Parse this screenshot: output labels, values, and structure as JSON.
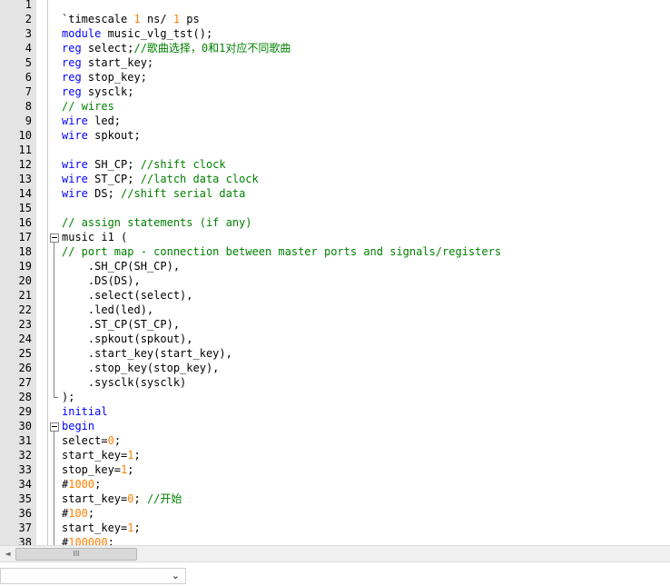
{
  "editor": {
    "lines": [
      {
        "n": "1",
        "tokens": []
      },
      {
        "n": "2",
        "tokens": [
          {
            "t": "`timescale ",
            "c": ""
          },
          {
            "t": "1",
            "c": "num"
          },
          {
            "t": " ns/ ",
            "c": ""
          },
          {
            "t": "1",
            "c": "num"
          },
          {
            "t": " ps",
            "c": ""
          }
        ]
      },
      {
        "n": "3",
        "tokens": [
          {
            "t": "module",
            "c": "kw"
          },
          {
            "t": " music_vlg_tst();",
            "c": ""
          }
        ]
      },
      {
        "n": "4",
        "tokens": [
          {
            "t": "reg",
            "c": "kw"
          },
          {
            "t": " select;",
            "c": ""
          },
          {
            "t": "//歌曲选择，0和1对应不同歌曲",
            "c": "cm"
          }
        ]
      },
      {
        "n": "5",
        "tokens": [
          {
            "t": "reg",
            "c": "kw"
          },
          {
            "t": " start_key;",
            "c": ""
          }
        ]
      },
      {
        "n": "6",
        "tokens": [
          {
            "t": "reg",
            "c": "kw"
          },
          {
            "t": " stop_key;",
            "c": ""
          }
        ]
      },
      {
        "n": "7",
        "tokens": [
          {
            "t": "reg",
            "c": "kw"
          },
          {
            "t": " sysclk;",
            "c": ""
          }
        ]
      },
      {
        "n": "8",
        "tokens": [
          {
            "t": "// wires",
            "c": "cm"
          }
        ]
      },
      {
        "n": "9",
        "tokens": [
          {
            "t": "wire",
            "c": "kw"
          },
          {
            "t": " led;",
            "c": ""
          }
        ]
      },
      {
        "n": "10",
        "tokens": [
          {
            "t": "wire",
            "c": "kw"
          },
          {
            "t": " spkout;",
            "c": ""
          }
        ]
      },
      {
        "n": "11",
        "tokens": []
      },
      {
        "n": "12",
        "tokens": [
          {
            "t": "wire",
            "c": "kw"
          },
          {
            "t": " SH_CP; ",
            "c": ""
          },
          {
            "t": "//shift clock",
            "c": "cm"
          }
        ]
      },
      {
        "n": "13",
        "tokens": [
          {
            "t": "wire",
            "c": "kw"
          },
          {
            "t": " ST_CP; ",
            "c": ""
          },
          {
            "t": "//latch data clock",
            "c": "cm"
          }
        ]
      },
      {
        "n": "14",
        "tokens": [
          {
            "t": "wire",
            "c": "kw"
          },
          {
            "t": " DS; ",
            "c": ""
          },
          {
            "t": "//shift serial data",
            "c": "cm"
          }
        ]
      },
      {
        "n": "15",
        "tokens": []
      },
      {
        "n": "16",
        "tokens": [
          {
            "t": "// assign statements (if any)",
            "c": "cm"
          }
        ]
      },
      {
        "n": "17",
        "tokens": [
          {
            "t": "music i1 (",
            "c": ""
          }
        ]
      },
      {
        "n": "18",
        "tokens": [
          {
            "t": "// port map - connection between master ports and signals/registers",
            "c": "cm"
          }
        ]
      },
      {
        "n": "19",
        "tokens": [
          {
            "t": "    .SH_CP(SH_CP),",
            "c": ""
          }
        ]
      },
      {
        "n": "20",
        "tokens": [
          {
            "t": "    .DS(DS),",
            "c": ""
          }
        ]
      },
      {
        "n": "21",
        "tokens": [
          {
            "t": "    .select(select),",
            "c": ""
          }
        ]
      },
      {
        "n": "22",
        "tokens": [
          {
            "t": "    .led(led),",
            "c": ""
          }
        ]
      },
      {
        "n": "23",
        "tokens": [
          {
            "t": "    .ST_CP(ST_CP),",
            "c": ""
          }
        ]
      },
      {
        "n": "24",
        "tokens": [
          {
            "t": "    .spkout(spkout),",
            "c": ""
          }
        ]
      },
      {
        "n": "25",
        "tokens": [
          {
            "t": "    .start_key(start_key),",
            "c": ""
          }
        ]
      },
      {
        "n": "26",
        "tokens": [
          {
            "t": "    .stop_key(stop_key),",
            "c": ""
          }
        ]
      },
      {
        "n": "27",
        "tokens": [
          {
            "t": "    .sysclk(sysclk)",
            "c": ""
          }
        ]
      },
      {
        "n": "28",
        "tokens": [
          {
            "t": ");",
            "c": ""
          }
        ]
      },
      {
        "n": "29",
        "tokens": [
          {
            "t": "initial",
            "c": "kw"
          }
        ]
      },
      {
        "n": "30",
        "tokens": [
          {
            "t": "begin",
            "c": "kw"
          }
        ]
      },
      {
        "n": "31",
        "tokens": [
          {
            "t": "select=",
            "c": ""
          },
          {
            "t": "0",
            "c": "num"
          },
          {
            "t": ";",
            "c": ""
          }
        ]
      },
      {
        "n": "32",
        "tokens": [
          {
            "t": "start_key=",
            "c": ""
          },
          {
            "t": "1",
            "c": "num"
          },
          {
            "t": ";",
            "c": ""
          }
        ]
      },
      {
        "n": "33",
        "tokens": [
          {
            "t": "stop_key=",
            "c": ""
          },
          {
            "t": "1",
            "c": "num"
          },
          {
            "t": ";",
            "c": ""
          }
        ]
      },
      {
        "n": "34",
        "tokens": [
          {
            "t": "#",
            "c": ""
          },
          {
            "t": "1000",
            "c": "num"
          },
          {
            "t": ";",
            "c": ""
          }
        ]
      },
      {
        "n": "35",
        "tokens": [
          {
            "t": "start_key=",
            "c": ""
          },
          {
            "t": "0",
            "c": "num"
          },
          {
            "t": "; ",
            "c": ""
          },
          {
            "t": "//开始",
            "c": "cm"
          }
        ]
      },
      {
        "n": "36",
        "tokens": [
          {
            "t": "#",
            "c": ""
          },
          {
            "t": "100",
            "c": "num"
          },
          {
            "t": ";",
            "c": ""
          }
        ]
      },
      {
        "n": "37",
        "tokens": [
          {
            "t": "start_key=",
            "c": ""
          },
          {
            "t": "1",
            "c": "num"
          },
          {
            "t": ";",
            "c": ""
          }
        ]
      },
      {
        "n": "38",
        "tokens": [
          {
            "t": "#",
            "c": ""
          },
          {
            "t": "100000",
            "c": "num"
          },
          {
            "t": ";",
            "c": ""
          }
        ]
      }
    ]
  },
  "hscrollbar": {
    "left_arrow": "◄",
    "thumb_grip": "III"
  },
  "statusbar": {
    "dropdown_value": "",
    "dropdown_arrow": "⌄"
  },
  "colors": {
    "keyword": "#0000ff",
    "comment": "#008000",
    "number": "#ff8000",
    "gutter": "#e4e4e4"
  }
}
